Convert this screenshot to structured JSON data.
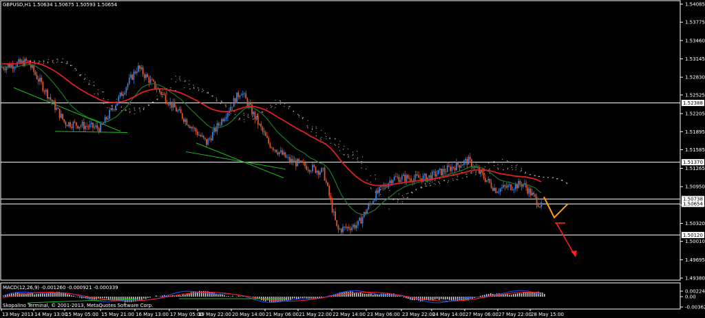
{
  "chart_title": "GBPUSD,H1  1.50634 1.50675 1.50593 1.50654",
  "macd_label": "MACD(12,26,9) -0.001260 -0.000921 -0.000339",
  "footer": "Skopalino Terminal, © 2001-2013, MetaQuotes Software Corp.",
  "colors": {
    "background": "#000000",
    "bull_candle": "#3b7fd6",
    "bear_candle": "#e0562a",
    "ema_fast": "#1f7a2a",
    "ema_slow": "#e02020",
    "cloud": "#c8b8b0",
    "hline": "#ffffff",
    "macd_hist": "#c8c8c8",
    "macd_line": "#2050ff",
    "signal_line": "#ff2020",
    "trend_green": "#20c020",
    "projection_orange": "#ff9a1a",
    "projection_red": "#ff2020"
  },
  "price_axis": {
    "ticks": [
      "1.54085",
      "1.53775",
      "1.53460",
      "1.53145",
      "1.52830",
      "1.52525",
      "1.52205",
      "1.51895",
      "1.51585",
      "1.51265",
      "1.50950",
      "1.50635",
      "1.50320",
      "1.50010",
      "1.49695",
      "1.49380"
    ],
    "boxed_levels": [
      "1.52388",
      "1.51370",
      "1.50738",
      "1.50654",
      "1.50120"
    ]
  },
  "macd_axis": {
    "ticks": [
      "0.002244",
      "0.00",
      "-0.003627"
    ]
  },
  "time_axis": {
    "labels": [
      "13 May 2013",
      "14 May 13:00",
      "15 May 05:00",
      "15 May 21:00",
      "16 May 13:00",
      "17 May 05:00",
      "19 May 22:00",
      "20 May 14:00",
      "21 May 06:00",
      "21 May 22:00",
      "22 May 14:00",
      "23 May 06:00",
      "23 May 22:00",
      "24 May 14:00",
      "27 May 06:00",
      "27 May 22:00",
      "28 May 15:00"
    ]
  },
  "chart_data": {
    "type": "candlestick",
    "symbol": "GBPUSD",
    "timeframe": "H1",
    "ohlc_current": {
      "open": 1.50634,
      "high": 1.50675,
      "low": 1.50593,
      "close": 1.50654
    },
    "x": [
      "13 May 2013",
      "14 May 13:00",
      "15 May 05:00",
      "15 May 21:00",
      "16 May 13:00",
      "17 May 05:00",
      "19 May 22:00",
      "20 May 14:00",
      "21 May 06:00",
      "21 May 22:00",
      "22 May 14:00",
      "23 May 06:00",
      "23 May 22:00",
      "24 May 14:00",
      "27 May 06:00",
      "27 May 22:00",
      "28 May 15:00"
    ],
    "close": [
      1.53,
      1.519,
      1.5205,
      1.521,
      1.53,
      1.524,
      1.515,
      1.521,
      1.517,
      1.513,
      1.503,
      1.508,
      1.511,
      1.5125,
      1.511,
      1.5095,
      1.5065
    ],
    "ylim": [
      1.4938,
      1.54085
    ],
    "horizontal_levels": [
      1.52388,
      1.5137,
      1.50738,
      1.50654,
      1.5012
    ],
    "macd": {
      "fast": 12,
      "slow": 26,
      "signal": 9,
      "main": -0.00126,
      "signal_value": -0.000921,
      "histogram": -0.000339,
      "ylim": [
        -0.003627,
        0.002244
      ]
    }
  }
}
